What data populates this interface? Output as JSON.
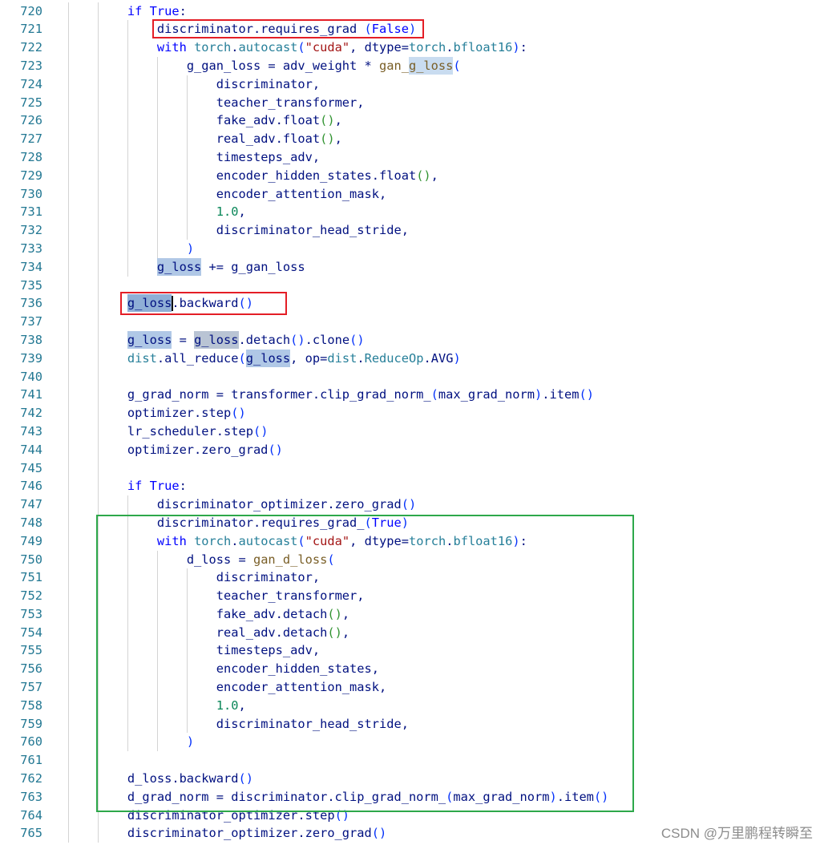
{
  "editor": {
    "lines": [
      {
        "n": "720",
        "code": [
          [
            "        "
          ],
          [
            "if",
            "#0000ff"
          ],
          [
            " "
          ],
          [
            "True",
            "#0000ff"
          ],
          [
            ":"
          ]
        ]
      },
      {
        "n": "721",
        "code": [
          [
            "            "
          ],
          [
            "discriminator.requires_grad "
          ],
          [
            "(",
            "#0431fa"
          ],
          [
            "False",
            "#0000ff"
          ],
          [
            ")",
            "#0431fa"
          ]
        ]
      },
      {
        "n": "722",
        "code": [
          [
            "            "
          ],
          [
            "with",
            "#0000ff"
          ],
          [
            " "
          ],
          [
            "torch",
            "#267f99"
          ],
          [
            "."
          ],
          [
            "autocast",
            "#267f99"
          ],
          [
            "(",
            "#0431fa"
          ],
          [
            "\"cuda\"",
            "#a31515"
          ],
          [
            ", dtype="
          ],
          [
            "torch",
            "#267f99"
          ],
          [
            "."
          ],
          [
            "bfloat16",
            "#267f99"
          ],
          [
            ")",
            "#0431fa"
          ],
          [
            ":"
          ]
        ]
      },
      {
        "n": "723",
        "code": [
          [
            "                "
          ],
          [
            "g_gan_loss = adv_weight * "
          ],
          [
            "gan_",
            "#795e26"
          ],
          [
            "g_loss",
            "#795e26",
            "#c9dcf0"
          ],
          [
            "(",
            "#0431fa"
          ]
        ]
      },
      {
        "n": "724",
        "code": [
          [
            "                    "
          ],
          [
            "discriminator,"
          ]
        ]
      },
      {
        "n": "725",
        "code": [
          [
            "                    "
          ],
          [
            "teacher_transformer,"
          ]
        ]
      },
      {
        "n": "726",
        "code": [
          [
            "                    "
          ],
          [
            "fake_adv.float"
          ],
          [
            "()",
            "#319331"
          ],
          [
            ","
          ]
        ]
      },
      {
        "n": "727",
        "code": [
          [
            "                    "
          ],
          [
            "real_adv.float"
          ],
          [
            "()",
            "#319331"
          ],
          [
            ","
          ]
        ]
      },
      {
        "n": "728",
        "code": [
          [
            "                    "
          ],
          [
            "timesteps_adv,"
          ]
        ]
      },
      {
        "n": "729",
        "code": [
          [
            "                    "
          ],
          [
            "encoder_hidden_states.float"
          ],
          [
            "()",
            "#319331"
          ],
          [
            ","
          ]
        ]
      },
      {
        "n": "730",
        "code": [
          [
            "                    "
          ],
          [
            "encoder_attention_mask,"
          ]
        ]
      },
      {
        "n": "731",
        "code": [
          [
            "                    "
          ],
          [
            "1.0",
            "#098658"
          ],
          [
            ","
          ]
        ]
      },
      {
        "n": "732",
        "code": [
          [
            "                    "
          ],
          [
            "discriminator_head_stride,"
          ]
        ]
      },
      {
        "n": "733",
        "code": [
          [
            "                "
          ],
          [
            ")",
            "#0431fa"
          ]
        ]
      },
      {
        "n": "734",
        "code": [
          [
            "            "
          ],
          [
            "g_loss",
            "#001080",
            "#b0c8e6"
          ],
          [
            " += g_gan_loss"
          ]
        ]
      },
      {
        "n": "735",
        "code": []
      },
      {
        "n": "736",
        "code": [
          [
            "        "
          ],
          [
            "g_loss",
            "#001080",
            "#8fafd6"
          ],
          [
            ".backward"
          ],
          [
            "()",
            "#0431fa"
          ]
        ]
      },
      {
        "n": "737",
        "code": []
      },
      {
        "n": "738",
        "code": [
          [
            "        "
          ],
          [
            "g_loss",
            "#001080",
            "#b0c8e6"
          ],
          [
            " = "
          ],
          [
            "g_loss",
            "#001080",
            "#b9c4d4"
          ],
          [
            ".detach"
          ],
          [
            "()",
            "#0431fa"
          ],
          [
            ".clone"
          ],
          [
            "()",
            "#0431fa"
          ]
        ]
      },
      {
        "n": "739",
        "code": [
          [
            "        "
          ],
          [
            "dist",
            "#267f99"
          ],
          [
            ".all_reduce"
          ],
          [
            "(",
            "#0431fa"
          ],
          [
            "g_loss",
            "#001080",
            "#b0c8e6"
          ],
          [
            ", op="
          ],
          [
            "dist",
            "#267f99"
          ],
          [
            "."
          ],
          [
            "ReduceOp",
            "#267f99"
          ],
          [
            ".AVG"
          ],
          [
            ")",
            "#0431fa"
          ]
        ]
      },
      {
        "n": "740",
        "code": []
      },
      {
        "n": "741",
        "code": [
          [
            "        "
          ],
          [
            "g_grad_norm = transformer.clip_grad_norm_"
          ],
          [
            "(",
            "#0431fa"
          ],
          [
            "max_grad_norm"
          ],
          [
            ")",
            "#0431fa"
          ],
          [
            ".item"
          ],
          [
            "()",
            "#0431fa"
          ]
        ]
      },
      {
        "n": "742",
        "code": [
          [
            "        "
          ],
          [
            "optimizer.step"
          ],
          [
            "()",
            "#0431fa"
          ]
        ]
      },
      {
        "n": "743",
        "code": [
          [
            "        "
          ],
          [
            "lr_scheduler.step"
          ],
          [
            "()",
            "#0431fa"
          ]
        ]
      },
      {
        "n": "744",
        "code": [
          [
            "        "
          ],
          [
            "optimizer.zero_grad"
          ],
          [
            "()",
            "#0431fa"
          ]
        ]
      },
      {
        "n": "745",
        "code": []
      },
      {
        "n": "746",
        "code": [
          [
            "        "
          ],
          [
            "if",
            "#0000ff"
          ],
          [
            " "
          ],
          [
            "True",
            "#0000ff"
          ],
          [
            ":"
          ]
        ]
      },
      {
        "n": "747",
        "code": [
          [
            "            "
          ],
          [
            "discriminator_optimizer.zero_grad"
          ],
          [
            "()",
            "#0431fa"
          ]
        ]
      },
      {
        "n": "748",
        "code": [
          [
            "            "
          ],
          [
            "discriminator.requires_grad_"
          ],
          [
            "(",
            "#0431fa"
          ],
          [
            "True",
            "#0000ff"
          ],
          [
            ")",
            "#0431fa"
          ]
        ]
      },
      {
        "n": "749",
        "code": [
          [
            "            "
          ],
          [
            "with",
            "#0000ff"
          ],
          [
            " "
          ],
          [
            "torch",
            "#267f99"
          ],
          [
            "."
          ],
          [
            "autocast",
            "#267f99"
          ],
          [
            "(",
            "#0431fa"
          ],
          [
            "\"cuda\"",
            "#a31515"
          ],
          [
            ", dtype="
          ],
          [
            "torch",
            "#267f99"
          ],
          [
            "."
          ],
          [
            "bfloat16",
            "#267f99"
          ],
          [
            ")",
            "#0431fa"
          ],
          [
            ":"
          ]
        ]
      },
      {
        "n": "750",
        "code": [
          [
            "                "
          ],
          [
            "d_loss = "
          ],
          [
            "gan_d_loss",
            "#795e26"
          ],
          [
            "(",
            "#0431fa"
          ]
        ]
      },
      {
        "n": "751",
        "code": [
          [
            "                    "
          ],
          [
            "discriminator,"
          ]
        ]
      },
      {
        "n": "752",
        "code": [
          [
            "                    "
          ],
          [
            "teacher_transformer,"
          ]
        ]
      },
      {
        "n": "753",
        "code": [
          [
            "                    "
          ],
          [
            "fake_adv.detach"
          ],
          [
            "()",
            "#319331"
          ],
          [
            ","
          ]
        ]
      },
      {
        "n": "754",
        "code": [
          [
            "                    "
          ],
          [
            "real_adv.detach"
          ],
          [
            "()",
            "#319331"
          ],
          [
            ","
          ]
        ]
      },
      {
        "n": "755",
        "code": [
          [
            "                    "
          ],
          [
            "timesteps_adv,"
          ]
        ]
      },
      {
        "n": "756",
        "code": [
          [
            "                    "
          ],
          [
            "encoder_hidden_states,"
          ]
        ]
      },
      {
        "n": "757",
        "code": [
          [
            "                    "
          ],
          [
            "encoder_attention_mask,"
          ]
        ]
      },
      {
        "n": "758",
        "code": [
          [
            "                    "
          ],
          [
            "1.0",
            "#098658"
          ],
          [
            ","
          ]
        ]
      },
      {
        "n": "759",
        "code": [
          [
            "                    "
          ],
          [
            "discriminator_head_stride,"
          ]
        ]
      },
      {
        "n": "760",
        "code": [
          [
            "                "
          ],
          [
            ")",
            "#0431fa"
          ]
        ]
      },
      {
        "n": "761",
        "code": []
      },
      {
        "n": "762",
        "code": [
          [
            "        "
          ],
          [
            "d_loss.backward"
          ],
          [
            "()",
            "#0431fa"
          ]
        ]
      },
      {
        "n": "763",
        "code": [
          [
            "        "
          ],
          [
            "d_grad_norm = discriminator.clip_grad_norm_"
          ],
          [
            "(",
            "#0431fa"
          ],
          [
            "max_grad_norm"
          ],
          [
            ")",
            "#0431fa"
          ],
          [
            ".item"
          ],
          [
            "()",
            "#0431fa"
          ]
        ]
      },
      {
        "n": "764",
        "code": [
          [
            "        "
          ],
          [
            "discriminator_optimizer.step"
          ],
          [
            "()",
            "#0431fa"
          ]
        ]
      },
      {
        "n": "765",
        "code": [
          [
            "        "
          ],
          [
            "discriminator_optimizer.zero_grad"
          ],
          [
            "()",
            "#0431fa"
          ]
        ]
      }
    ]
  },
  "watermark": "CSDN @万里鹏程转瞬至"
}
